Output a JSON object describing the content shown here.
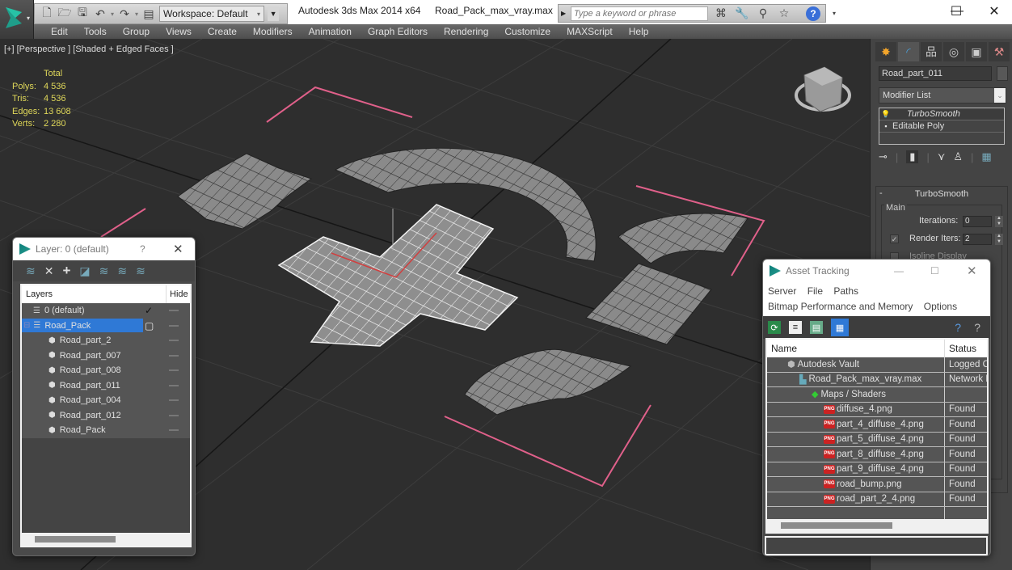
{
  "titlebar": {
    "workspace": "Workspace: Default",
    "app_title": "Autodesk 3ds Max  2014 x64",
    "file_title": "Road_Pack_max_vray.max",
    "search_placeholder": "Type a keyword or phrase",
    "minimize": "—",
    "maximize": "☐",
    "close": "✕"
  },
  "menu": [
    "Edit",
    "Tools",
    "Group",
    "Views",
    "Create",
    "Modifiers",
    "Animation",
    "Graph Editors",
    "Rendering",
    "Customize",
    "MAXScript",
    "Help"
  ],
  "viewport": {
    "label": "[+] [Perspective ] [Shaded + Edged Faces ]",
    "stats": {
      "header": "Total",
      "rows": [
        {
          "key": "Polys:",
          "value": "4 536"
        },
        {
          "key": "Tris:",
          "value": "4 536"
        },
        {
          "key": "Edges:",
          "value": "13 608"
        },
        {
          "key": "Verts:",
          "value": "2 280"
        }
      ]
    },
    "colors": {
      "stats": "#e0d85a",
      "selection_bracket": "#e0608a",
      "background": "#2e2e2e"
    }
  },
  "command_panel": {
    "object_name": "Road_part_011",
    "modifier_list": "Modifier List",
    "stack": [
      {
        "icon": "lightbulb-icon",
        "label": "TurboSmooth"
      },
      {
        "icon": "plus-box-icon",
        "label": "Editable Poly"
      }
    ],
    "rollout": {
      "title": "TurboSmooth",
      "group": "Main",
      "iterations_label": "Iterations:",
      "iterations_value": "0",
      "render_iters_label": "Render Iters:",
      "render_iters_value": "2",
      "render_iters_checked": true,
      "isoline_label": "Isoline Display"
    }
  },
  "layer_dialog": {
    "title": "Layer: 0 (default)",
    "help": "?",
    "close": "✕",
    "columns": {
      "layers": "Layers",
      "hide": "Hide"
    },
    "rows": [
      {
        "name": "0 (default)",
        "level": 1,
        "type": "layer",
        "current": true,
        "selected": false
      },
      {
        "name": "Road_Pack",
        "level": 1,
        "type": "layer",
        "current": false,
        "selected": true
      },
      {
        "name": "Road_part_2",
        "level": 2,
        "type": "object"
      },
      {
        "name": "Road_part_007",
        "level": 2,
        "type": "object"
      },
      {
        "name": "Road_part_008",
        "level": 2,
        "type": "object"
      },
      {
        "name": "Road_part_011",
        "level": 2,
        "type": "object"
      },
      {
        "name": "Road_part_004",
        "level": 2,
        "type": "object"
      },
      {
        "name": "Road_part_012",
        "level": 2,
        "type": "object"
      },
      {
        "name": "Road_Pack",
        "level": 2,
        "type": "object"
      }
    ],
    "selection_color": "#2f79d6"
  },
  "asset_dialog": {
    "title": "Asset Tracking",
    "menu_row1": [
      "Server",
      "File",
      "Paths"
    ],
    "menu_row2": [
      "Bitmap Performance and Memory",
      "Options"
    ],
    "columns": {
      "name": "Name",
      "status": "Status"
    },
    "rows": [
      {
        "name": "Autodesk Vault",
        "status": "Logged O",
        "icon": "vault-icon",
        "indent": 1
      },
      {
        "name": "Road_Pack_max_vray.max",
        "status": "Network F",
        "icon": "max-file-icon",
        "indent": 2
      },
      {
        "name": "Maps / Shaders",
        "status": "",
        "icon": "maps-icon",
        "indent": 3
      },
      {
        "name": "diffuse_4.png",
        "status": "Found",
        "icon": "png-icon",
        "indent": 4
      },
      {
        "name": "part_4_diffuse_4.png",
        "status": "Found",
        "icon": "png-icon",
        "indent": 4
      },
      {
        "name": "part_5_diffuse_4.png",
        "status": "Found",
        "icon": "png-icon",
        "indent": 4
      },
      {
        "name": "part_8_diffuse_4.png",
        "status": "Found",
        "icon": "png-icon",
        "indent": 4
      },
      {
        "name": "part_9_diffuse_4.png",
        "status": "Found",
        "icon": "png-icon",
        "indent": 4
      },
      {
        "name": "road_bump.png",
        "status": "Found",
        "icon": "png-icon",
        "indent": 4
      },
      {
        "name": "road_part_2_4.png",
        "status": "Found",
        "icon": "png-icon",
        "indent": 4
      }
    ],
    "png_label": "PNG"
  }
}
